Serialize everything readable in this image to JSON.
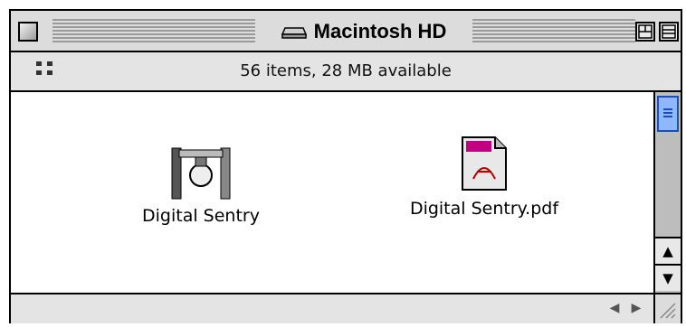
{
  "window": {
    "title": "Macintosh HD",
    "info": "56 items, 28 MB available"
  },
  "icons": [
    {
      "label": "Digital Sentry",
      "icon": "application-icon"
    },
    {
      "label": "Digital Sentry.pdf",
      "icon": "pdf-document-icon"
    }
  ],
  "colors": {
    "chrome": "#dcdcdc",
    "content": "#ffffff",
    "scroll_thumb": "#8fb7ff"
  }
}
